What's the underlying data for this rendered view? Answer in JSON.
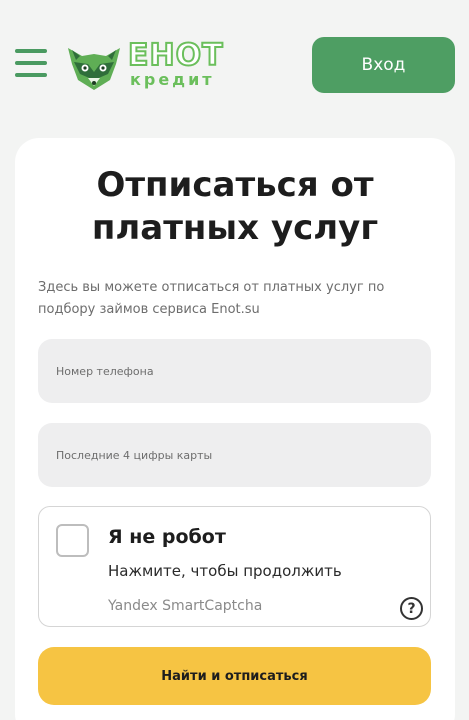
{
  "header": {
    "menu_icon": "hamburger-menu-icon",
    "logo": {
      "name": "ЕНОТ",
      "sub": "кредит",
      "icon": "raccoon-logo"
    },
    "login_label": "Вход"
  },
  "form": {
    "title_line1": "Отписаться от",
    "title_line2": "платных услуг",
    "description": "Здесь вы можете отписаться от платных услуг по подбору займов сервиса Enot.su",
    "phone_placeholder": "Номер телефона",
    "card_placeholder": "Последние 4 цифры карты",
    "captcha": {
      "title": "Я не робот",
      "hint": "Нажмите, чтобы продолжить",
      "brand": "Yandex SmartCaptcha",
      "help_symbol": "?"
    },
    "submit_label": "Найти и отписаться"
  },
  "colors": {
    "brand_green": "#4e9e63",
    "logo_green": "#6bbf5c",
    "accent_yellow": "#f6c443",
    "background": "#f3f4f3"
  }
}
